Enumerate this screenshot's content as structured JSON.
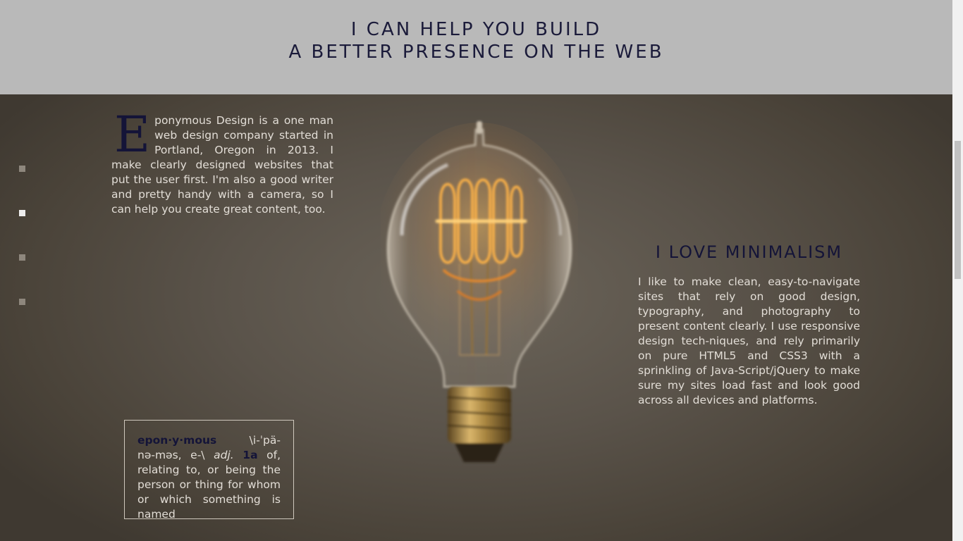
{
  "header": {
    "line1": "I CAN HELP YOU BUILD",
    "line2": "A BETTER PRESENCE ON THE WEB"
  },
  "nav": {
    "dots": [
      {
        "label": "section-1",
        "active": false
      },
      {
        "label": "section-2",
        "active": true
      },
      {
        "label": "section-3",
        "active": false
      },
      {
        "label": "section-4",
        "active": false
      }
    ]
  },
  "intro": {
    "dropcap": "E",
    "text": "ponymous Design is a one man web design company started in Portland, Oregon in 2013. I make clearly designed websites that put the user first. I'm also a good writer and pretty handy with a camera, so I can help you create great content, too."
  },
  "minimalism": {
    "heading": "I LOVE MINIMALISM",
    "body": "I like to make clean, easy-to-navigate sites that rely on good design, typography, and photography to present content clearly. I use responsive design tech-niques, and rely primarily on pure HTML5 and CSS3 with a sprinkling of Java-Script/jQuery to make sure my sites load fast and look good across all devices and platforms."
  },
  "definition": {
    "word": "epon·y·mous",
    "pronunciation": "\\i-ˈpä-nə-məs, e-\\",
    "pos": "adj.",
    "sense": "1a",
    "meaning": "of, relating to, or being the person or thing for whom or which something is named"
  },
  "colors": {
    "header_bg": "#b9b9b9",
    "accent_navy": "#141438",
    "body_text": "#e2ddd6"
  }
}
